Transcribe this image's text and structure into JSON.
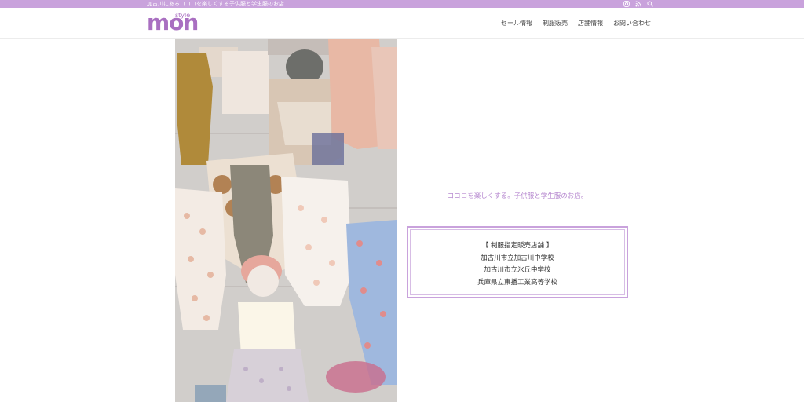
{
  "topbar": {
    "tagline": "加古川にあるココロを楽しくする子供服と学生服のお店",
    "icons": [
      "instagram-icon",
      "rss-icon",
      "search-icon"
    ]
  },
  "header": {
    "logo": {
      "main": "mon",
      "sub": "style"
    },
    "nav": [
      {
        "label": "セール情報"
      },
      {
        "label": "制服販売"
      },
      {
        "label": "店舗情報"
      },
      {
        "label": "お問い合わせ"
      }
    ]
  },
  "main": {
    "catch": "ココロを楽しくする。子供服と学生服のお店。",
    "uniform_box": {
      "title": "【 制服指定販売店舗 】",
      "schools": [
        "加古川市立加古川中学校",
        "加古川市立氷丘中学校",
        "兵庫県立東播工業高等学校"
      ]
    }
  },
  "colors": {
    "accent": "#c9a2dc",
    "logo": "#a96fc1",
    "catch": "#b78ad0"
  }
}
